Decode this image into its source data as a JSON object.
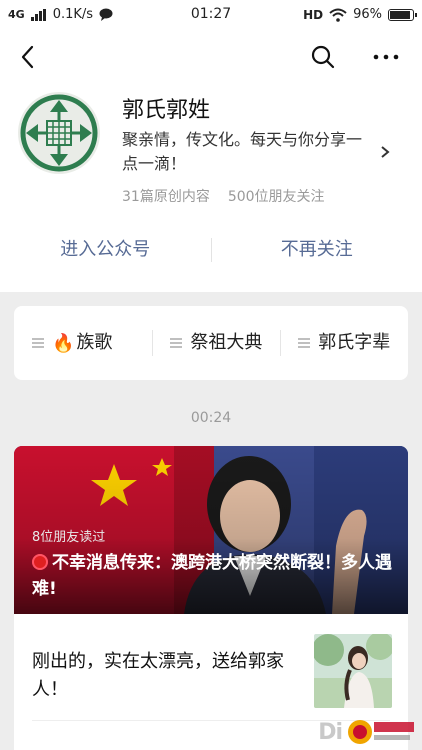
{
  "status_bar": {
    "network": "4G",
    "speed": "0.1K/s",
    "time": "01:27",
    "hd": "HD",
    "battery": "96%",
    "battery_level": 0.96
  },
  "profile": {
    "name": "郭氏郭姓",
    "description": "聚亲情，传文化。每天与你分享一点一滴！",
    "original_count": "31篇原创内容",
    "followers": "500位朋友关注",
    "enter_label": "进入公众号",
    "unfollow_label": "不再关注"
  },
  "menu": {
    "items": [
      {
        "label": "族歌",
        "icon": "fire-emoji"
      },
      {
        "label": "祭祖大典"
      },
      {
        "label": "郭氏字辈"
      }
    ]
  },
  "feed": {
    "time": "00:24",
    "cover_article": {
      "read_count": "8位朋友读过",
      "title": "不幸消息传来：澳跨港大桥突然断裂！多人遇难!"
    },
    "sub_article": {
      "title": "刚出的，实在太漂亮，送给郭家人！"
    }
  },
  "watermark": {
    "text": "Di",
    "logo_text": "中华郭氏网"
  },
  "colors": {
    "link_blue": "#576b95",
    "accent_green": "#2e7d4f",
    "flag_red": "#c8102e"
  }
}
